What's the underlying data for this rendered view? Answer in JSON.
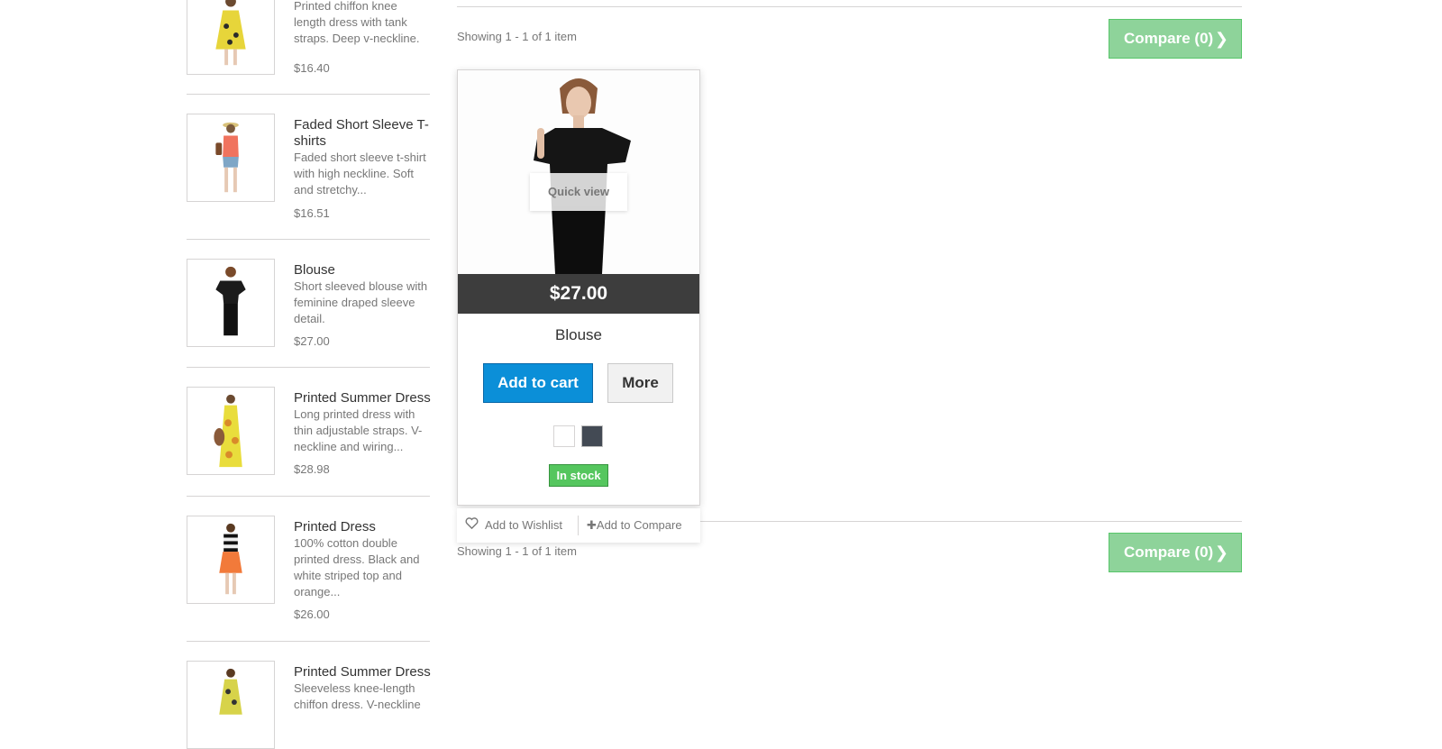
{
  "sidebar": {
    "items": [
      {
        "name": "",
        "description": "Printed chiffon knee length dress with tank straps. Deep v-neckline.",
        "price": "$16.40"
      },
      {
        "name": "Faded Short Sleeve T-shirts",
        "description": "Faded short sleeve t-shirt with high neckline. Soft and stretchy...",
        "price": "$16.51"
      },
      {
        "name": "Blouse",
        "description": "Short sleeved blouse with feminine draped sleeve detail.",
        "price": "$27.00"
      },
      {
        "name": "Printed Summer Dress",
        "description": "Long printed dress with thin adjustable straps. V-neckline and wiring...",
        "price": "$28.98"
      },
      {
        "name": "Printed Dress",
        "description": "100% cotton double printed dress. Black and white striped top and orange...",
        "price": "$26.00"
      },
      {
        "name": "Printed Summer Dress",
        "description": "Sleeveless knee-length chiffon dress. V-neckline",
        "price": ""
      }
    ]
  },
  "listing": {
    "showing_top": "Showing 1 - 1 of 1 item",
    "showing_bottom": "Showing 1 - 1 of 1 item",
    "compare_label": "Compare (0)"
  },
  "product": {
    "name": "Blouse",
    "price": "$27.00",
    "quick_view": "Quick view",
    "add_to_cart": "Add to cart",
    "more": "More",
    "stock": "In stock",
    "add_to_wishlist": "Add to Wishlist",
    "add_to_compare": "Add to Compare",
    "colors": [
      "#ffffff",
      "#434a54"
    ]
  },
  "icons": {
    "compare_chevron": "chevron-right-icon",
    "wishlist": "heart-icon",
    "compare_plus": "plus-icon"
  }
}
